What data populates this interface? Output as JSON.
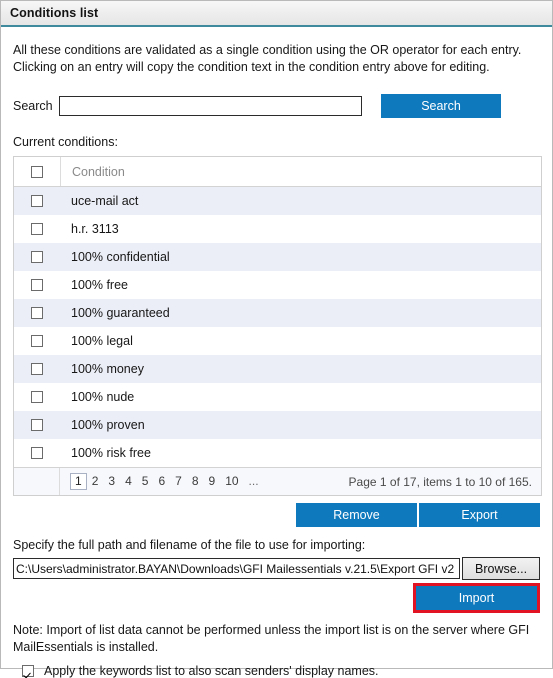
{
  "window": {
    "title": "Conditions list",
    "accent_blue": "#0f79bd",
    "highlight_red": "#e21423",
    "title_underline": "#3f8a9c"
  },
  "intro": {
    "line1": "All these conditions are validated as a single condition using the OR operator for each entry.",
    "line2": "Clicking on an entry will copy the condition text in the condition entry above for editing."
  },
  "search": {
    "label": "Search",
    "value": "",
    "placeholder": "",
    "button_label": "Search"
  },
  "grid": {
    "caption": "Current conditions:",
    "header": {
      "checkbox_checked": false,
      "column_label": "Condition"
    },
    "rows": [
      {
        "condition": "uce-mail act",
        "checked": false
      },
      {
        "condition": "h.r. 3113",
        "checked": false
      },
      {
        "condition": "100% confidential",
        "checked": false
      },
      {
        "condition": "100% free",
        "checked": false
      },
      {
        "condition": "100% guaranteed",
        "checked": false
      },
      {
        "condition": "100% legal",
        "checked": false
      },
      {
        "condition": "100% money",
        "checked": false
      },
      {
        "condition": "100% nude",
        "checked": false
      },
      {
        "condition": "100% proven",
        "checked": false
      },
      {
        "condition": "100% risk free",
        "checked": false
      }
    ],
    "pager": {
      "pages": [
        "1",
        "2",
        "3",
        "4",
        "5",
        "6",
        "7",
        "8",
        "9",
        "10",
        "..."
      ],
      "current_page": "1",
      "status": "Page 1 of 17, items 1 to 10 of 165."
    }
  },
  "actions": {
    "remove_label": "Remove",
    "export_label": "Export"
  },
  "import": {
    "hint": "Specify the full path and filename of the file to use for importing:",
    "path_value": "C:\\Users\\administrator.BAYAN\\Downloads\\GFI Mailessentials v.21.5\\Export GFI v2",
    "path_placeholder": "",
    "browse_label": "Browse...",
    "import_label": "Import",
    "note_line1": "Note: Import of list data cannot be performed unless the import list is on the server where GFI",
    "note_line2": "MailEssentials is installed."
  },
  "footer": {
    "apply_keywords_checked": true,
    "apply_keywords_label": "Apply the keywords list to also scan senders' display names."
  }
}
